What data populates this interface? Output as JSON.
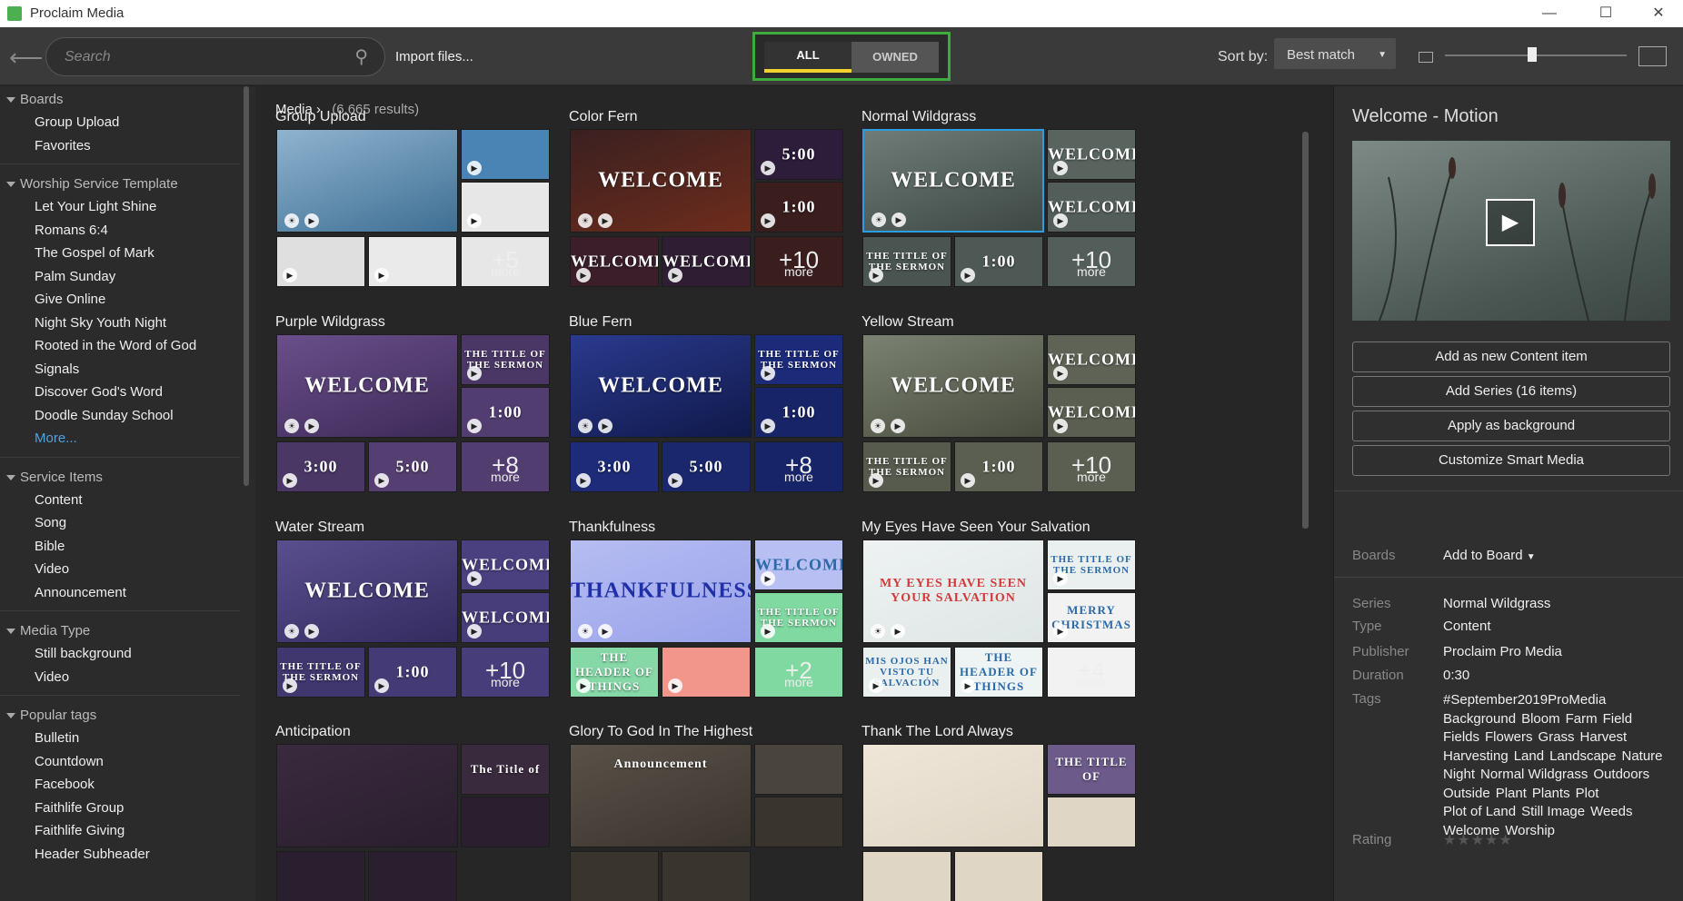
{
  "window": {
    "title": "Proclaim Media",
    "minimize": "—",
    "maximize": "☐",
    "close": "✕"
  },
  "toolbar": {
    "search_placeholder": "Search",
    "import_label": "Import files...",
    "filter_all": "ALL",
    "filter_owned": "OWNED",
    "sort_label": "Sort by:",
    "sort_value": "Best match",
    "zoom_level": 0.48
  },
  "sidebar": {
    "sections": [
      {
        "title": "Boards",
        "items": [
          "Group Upload",
          "Favorites"
        ]
      },
      {
        "title": "Worship Service Template",
        "items": [
          "Let Your Light Shine",
          "Romans 6:4",
          "The Gospel of Mark",
          "Palm Sunday",
          "Give Online",
          "Night Sky Youth Night",
          "Rooted in the Word of God",
          "Signals",
          "Discover God's Word",
          "Doodle Sunday School"
        ],
        "more": "More..."
      },
      {
        "title": "Service Items",
        "items": [
          "Content",
          "Song",
          "Bible",
          "Video",
          "Announcement"
        ]
      },
      {
        "title": "Media Type",
        "items": [
          "Still background",
          "Video"
        ]
      },
      {
        "title": "Popular tags",
        "items": [
          "Bulletin",
          "Countdown",
          "Facebook",
          "Faithlife Group",
          "Faithlife Giving",
          "Header Subheader"
        ]
      }
    ]
  },
  "main": {
    "breadcrumb": "Media",
    "result_count": "(6,665 results)",
    "groups": [
      {
        "title": "Group Upload",
        "main_text": "",
        "more": "+5",
        "more_label": "more",
        "bg": [
          "#8fb3cf",
          "#3e6f93"
        ],
        "small": [
          "",
          "",
          "",
          ""
        ],
        "smallbg": [
          "#4a84b5",
          "#e7e7e7",
          "#dfdfdf",
          "#eaeaea"
        ]
      },
      {
        "title": "Color Fern",
        "main_text": "WELCOME",
        "more": "+10",
        "more_label": "more",
        "bg": [
          "#3a2020",
          "#6e2c1c"
        ],
        "small": [
          "5:00",
          "1:00",
          "WELCOME",
          "WELCOME"
        ],
        "smallbg": [
          "#2d1c3a",
          "#3a1d1d",
          "#3b1e2a",
          "#2f1d33"
        ]
      },
      {
        "title": "Normal Wildgrass",
        "main_text": "WELCOME",
        "more": "+10",
        "more_label": "more",
        "bg": [
          "#6f7c77",
          "#3d4844"
        ],
        "small": [
          "WELCOME",
          "WELCOME",
          "THE TITLE OF THE SERMON",
          "1:00"
        ],
        "smallbg": [
          "#59645f",
          "#535e5a",
          "#4a5450",
          "#4e5854"
        ]
      },
      {
        "title": "Purple Wildgrass",
        "main_text": "WELCOME",
        "more": "+8",
        "more_label": "more",
        "bg": [
          "#6a4f8a",
          "#3d2a58"
        ],
        "small": [
          "THE TITLE OF THE SERMON",
          "1:00",
          "3:00",
          "5:00"
        ],
        "smallbg": [
          "#4a3766",
          "#523d70",
          "#4a3766",
          "#553f72"
        ]
      },
      {
        "title": "Blue Fern",
        "main_text": "WELCOME",
        "more": "+8",
        "more_label": "more",
        "bg": [
          "#2a3a8e",
          "#10194a"
        ],
        "small": [
          "THE TITLE OF THE SERMON",
          "1:00",
          "3:00",
          "5:00"
        ],
        "smallbg": [
          "#1c2a7a",
          "#182468",
          "#1d2b78",
          "#1a276d"
        ]
      },
      {
        "title": "Yellow Stream",
        "main_text": "WELCOME",
        "more": "+10",
        "more_label": "more",
        "bg": [
          "#7c8271",
          "#474c3e"
        ],
        "small": [
          "WELCOME",
          "WELCOME",
          "THE TITLE OF THE SERMON",
          "1:00"
        ],
        "smallbg": [
          "#5e6355",
          "#5a5f51",
          "#565b4d",
          "#5a5f51"
        ]
      },
      {
        "title": "Water Stream",
        "main_text": "WELCOME",
        "more": "+10",
        "more_label": "more",
        "bg": [
          "#5a4f8e",
          "#342b60"
        ],
        "small": [
          "WELCOME",
          "WELCOME",
          "THE TITLE OF THE SERMON",
          "1:00"
        ],
        "smallbg": [
          "#4a4080",
          "#463d7a",
          "#40376f",
          "#443b76"
        ]
      },
      {
        "title": "Thankfulness",
        "main_text": "THANKFULNESS",
        "more": "+2",
        "more_label": "more",
        "bg": [
          "#b6bdf2",
          "#9aa3ea"
        ],
        "small": [
          "WELCOME",
          "THE TITLE OF THE SERMON",
          "THE HEADER OF THINGS",
          ""
        ],
        "smallbg": [
          "#b8bff2",
          "#7fd9a1",
          "#86d9a7",
          "#f2968c"
        ]
      },
      {
        "title": "My Eyes Have Seen Your Salvation",
        "main_text": "MY EYES HAVE SEEN YOUR SALVATION",
        "more": "+4",
        "more_label": "more",
        "bg": [
          "#eef2f2",
          "#dfe6e6"
        ],
        "small": [
          "THE TITLE OF THE SERMON",
          "MERRY CHRISTMAS",
          "MIS OJOS HAN VISTO TU SALVACIÓN",
          "THE HEADER OF THINGS"
        ],
        "smallbg": [
          "#eaf0f0",
          "#f2f2f2",
          "#eaf0f0",
          "#eef3f3"
        ]
      },
      {
        "title": "Anticipation",
        "main_text": "",
        "more": "",
        "more_label": "",
        "bg": [
          "#3a2a3e",
          "#2a1f2e"
        ],
        "small": [
          "The Title of",
          "",
          "",
          ""
        ],
        "smallbg": [
          "#3a2a3e",
          "#2a1f2e",
          "#2a1f2e",
          "#2a1f2e"
        ]
      },
      {
        "title": "Glory To God In The Highest",
        "main_text": "Announcement",
        "more": "",
        "more_label": "",
        "bg": [
          "#5a5248",
          "#3a342e"
        ],
        "small": [
          "",
          "",
          "",
          ""
        ],
        "smallbg": [
          "#4a443e",
          "#3a342e",
          "#3a342e",
          "#3a342e"
        ]
      },
      {
        "title": "Thank The Lord Always",
        "main_text": "",
        "more": "",
        "more_label": "",
        "bg": [
          "#efe6d8",
          "#e0d6c6"
        ],
        "small": [
          "THE TITLE OF",
          "",
          "",
          ""
        ],
        "smallbg": [
          "#6b5a8a",
          "#e0d6c6",
          "#e0d6c6",
          "#e0d6c6"
        ]
      }
    ]
  },
  "panel": {
    "title": "Welcome - Motion",
    "actions": [
      "Add as new Content item",
      "Add Series (16 items)",
      "Apply as background",
      "Customize Smart Media"
    ],
    "boards_label": "Boards",
    "add_to_board": "Add to Board",
    "details": [
      {
        "label": "Series",
        "value": "Normal Wildgrass"
      },
      {
        "label": "Type",
        "value": "Content"
      },
      {
        "label": "Publisher",
        "value": "Proclaim Pro Media"
      },
      {
        "label": "Duration",
        "value": "0:30"
      }
    ],
    "tags_label": "Tags",
    "tags": [
      "#September2019ProMedia",
      "Background",
      "Bloom",
      "Farm",
      "Field",
      "Fields",
      "Flowers",
      "Grass",
      "Harvest",
      "Harvesting",
      "Land",
      "Landscape",
      "Nature",
      "Night",
      "Normal Wildgrass",
      "Outdoors",
      "Outside",
      "Plant",
      "Plants",
      "Plot",
      "Plot of Land",
      "Still Image",
      "Weeds",
      "Welcome",
      "Worship"
    ],
    "rating_label": "Rating",
    "rating_value": 0,
    "rating_stars": "★★★★★"
  }
}
